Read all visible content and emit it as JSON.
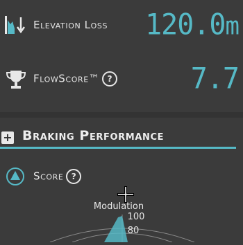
{
  "colors": {
    "accent": "#56b9c6",
    "background": "#3b3b3b",
    "text": "#e8e8e8"
  },
  "stats": [
    {
      "label": "Elevation Loss",
      "value": "120.0",
      "unit": "m",
      "icon": "descent-chart-icon"
    },
    {
      "label": "FlowScore™",
      "value": "7.7",
      "icon": "trophy-icon",
      "help": "?"
    }
  ],
  "section": {
    "expand_symbol": "+",
    "title": "Braking Performance"
  },
  "score": {
    "label": "Score",
    "help": "?",
    "icon": "triangle-circle-icon"
  },
  "chart_data": {
    "type": "radar",
    "axes": [
      "Modulation"
    ],
    "tick_labels": [
      "100",
      "80"
    ]
  }
}
